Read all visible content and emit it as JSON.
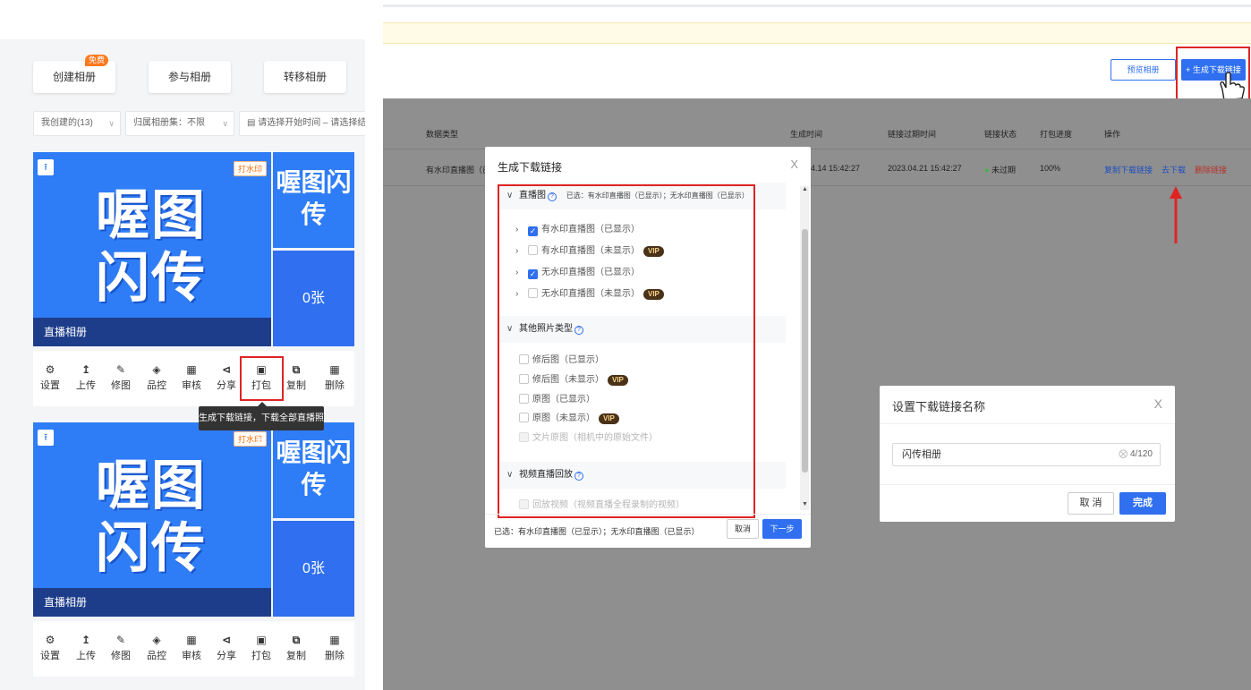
{
  "left": {
    "top_buttons": [
      "创建相册",
      "参与相册",
      "转移相册"
    ],
    "free_badge": "免费",
    "filters": {
      "mine": "我创建的(13)",
      "group": "归属相册集：不限",
      "date_range": "请选择开始时间 – 请选择结束时"
    },
    "albums": [
      {
        "cover_title_line1": "喔图",
        "cover_title_line2": "闪传",
        "watermark_badge": "打水印",
        "side_title": "喔图闪传",
        "photo_count": "0张",
        "name": "直播相册"
      },
      {
        "cover_title_line1": "喔图",
        "cover_title_line2": "闪传",
        "watermark_badge": "打水印",
        "side_title": "喔图闪传",
        "photo_count": "0张",
        "name": "直播相册"
      }
    ],
    "actions": [
      "设置",
      "上传",
      "修图",
      "品控",
      "审核",
      "分享",
      "打包",
      "复制",
      "删除"
    ],
    "tooltip": "生成下载链接，下载全部直播照片"
  },
  "right": {
    "preview_button": "预览相册",
    "generate_button": "+ 生成下载链接",
    "table": {
      "headers": [
        "数据类型",
        "生成时间",
        "链接过期时间",
        "链接状态",
        "打包进度",
        "操作"
      ],
      "row": {
        "type": "有水印直播图（已",
        "created": "4.14 15:42:27",
        "expires": "2023.04.21 15:42:27",
        "status": "未过期",
        "progress": "100%",
        "op_copy": "复制下载链接",
        "op_download": "去下载",
        "op_delete": "删除链接"
      }
    },
    "dialog1": {
      "title": "生成下载链接",
      "close": "X",
      "sections": [
        {
          "title": "直播图",
          "selected_hint": "已选：有水印直播图（已显示）；无水印直播图（已显示）"
        },
        {
          "title": "其他照片类型"
        },
        {
          "title": "视频直播回放"
        }
      ],
      "live_options": [
        {
          "label": "有水印直播图（已显示）",
          "checked": true,
          "vip": false
        },
        {
          "label": "有水印直播图（未显示）",
          "checked": false,
          "vip": true
        },
        {
          "label": "无水印直播图（已显示）",
          "checked": true,
          "vip": false
        },
        {
          "label": "无水印直播图（未显示）",
          "checked": false,
          "vip": true
        }
      ],
      "other_options": [
        {
          "label": "修后图（已显示）",
          "vip": false
        },
        {
          "label": "修后图（未显示）",
          "vip": true
        },
        {
          "label": "原图（已显示）",
          "vip": false
        },
        {
          "label": "原图（未显示）",
          "vip": true
        },
        {
          "label": "文片原图（相机中的原始文件）",
          "vip": false
        }
      ],
      "video_option": "回放视频（视频直播全程录制的视频）",
      "vip_label": "VIP",
      "footer_selected": "已选：有水印直播图（已显示）；无水印直播图（已显示）",
      "cancel": "取消",
      "next": "下一步"
    },
    "dialog2": {
      "title": "设置下载链接名称",
      "close": "X",
      "input_value": "闪传相册",
      "counter": "4/120",
      "cancel": "取 消",
      "done": "完成"
    }
  },
  "colors": {
    "brand_blue": "#2f6ff0",
    "highlight_red": "#e02424",
    "overlay_gray": "#8f8f8f"
  }
}
